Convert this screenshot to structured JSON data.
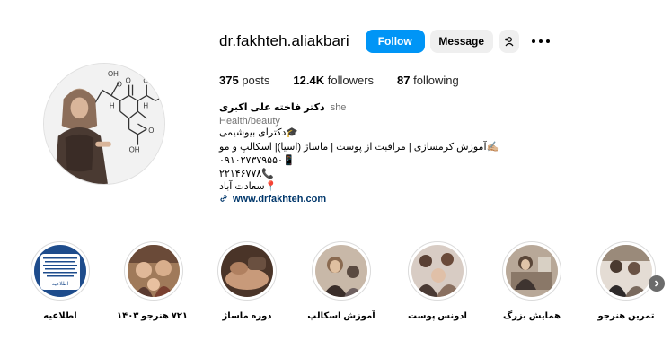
{
  "profile": {
    "username": "dr.fakhteh.aliakbari",
    "follow_label": "Follow",
    "message_label": "Message",
    "avatar_chem": {
      "oh1": "OH",
      "o1": "O",
      "nh1": "H",
      "nh2": "H",
      "o2": "O",
      "o3": "O",
      "oh2": "OH",
      "o4": "O"
    }
  },
  "stats": {
    "posts_count": "375",
    "posts_label": "posts",
    "followers_count": "12.4K",
    "followers_label": "followers",
    "following_count": "87",
    "following_label": "following"
  },
  "bio": {
    "full_name": "دکتر فاخته علی اکبری",
    "pronoun": "she",
    "category": "Health/beauty",
    "line1": "🎓دکترای بیوشیمی",
    "line2": "✍🏼آموزش کرمسازی | مراقبت از پوست | ماساژ (اسیا)| اسکالپ و مو",
    "line3": "۰۹۱۰۲۷۳۷۹۵۵۰📱",
    "line4": "۲۲۱۴۶۷۷۸📞",
    "line5": "📍سعادت آباد",
    "website": "www.drfakhteh.com"
  },
  "highlights": [
    {
      "label": "اطلاعیه",
      "color": "#1e4c8c"
    },
    {
      "label": "۷۲۱ هنرجو ۱۴۰۳",
      "color": "#7a5a3a"
    },
    {
      "label": "دوره ماساژ",
      "color": "#5a4030"
    },
    {
      "label": "آموزش اسکالپ",
      "color": "#6e5a4a"
    },
    {
      "label": "ادونس پوست",
      "color": "#8a7a70"
    },
    {
      "label": "همایش بزرگ",
      "color": "#6a5a50"
    },
    {
      "label": "تمرین هنرجو",
      "color": "#7a6a60"
    }
  ],
  "highlight_notice_text": {
    "body": "مهم",
    "footer": "اطلاعیه"
  },
  "colors": {
    "accent": "#0095f6",
    "button_gray": "#efefef",
    "link": "#00376b",
    "muted": "#737373"
  }
}
